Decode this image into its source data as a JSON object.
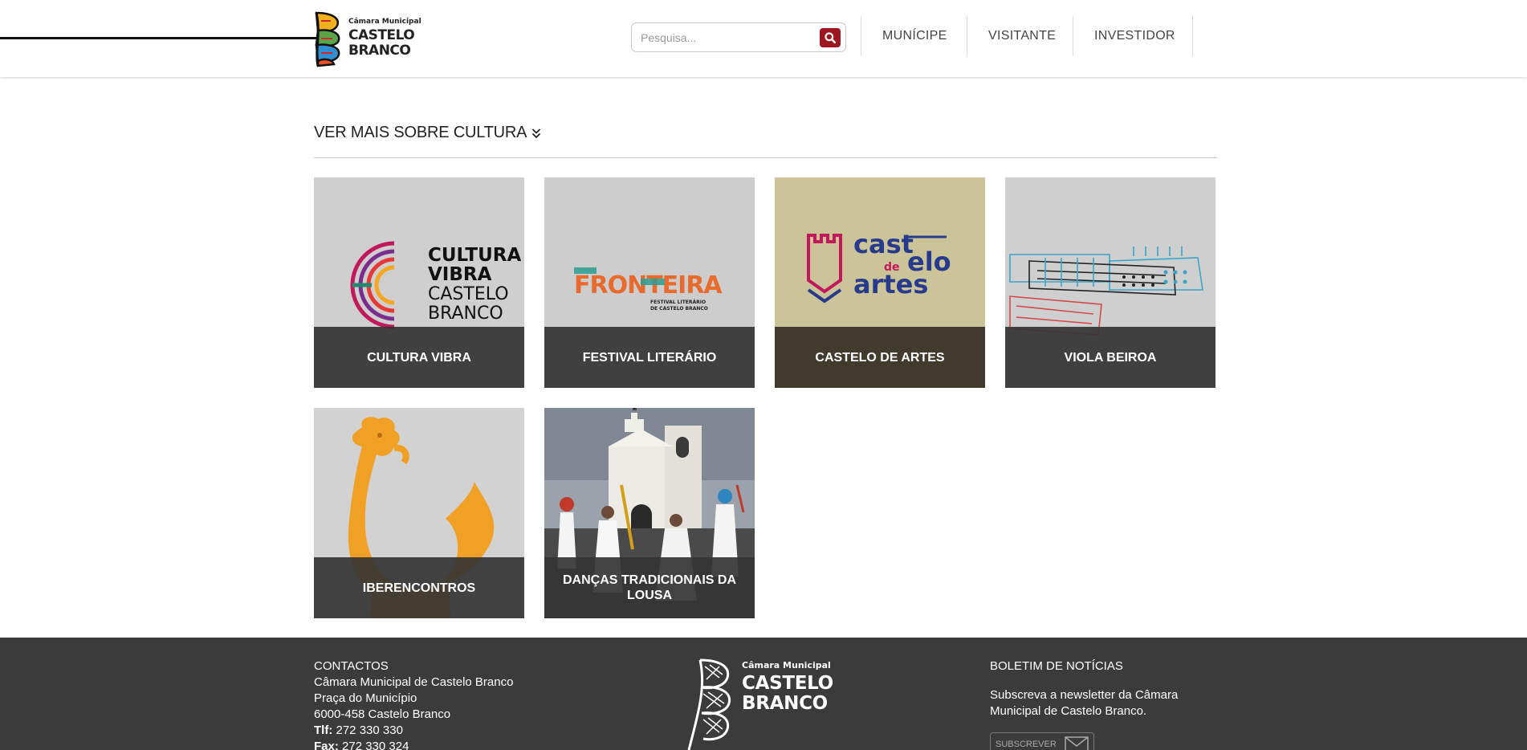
{
  "header": {
    "logo": {
      "small": "Câmara Municipal",
      "line1": "CASTELO",
      "line2": "BRANCO"
    },
    "search": {
      "placeholder": "Pesquisa..."
    },
    "nav": [
      "MUNÍCIPE",
      "VISITANTE",
      "INVESTIDOR"
    ],
    "colors": {
      "search_button": "#9e1620"
    }
  },
  "section": {
    "title": "VER MAIS SOBRE CULTURA",
    "cards": [
      {
        "label": "CULTURA VIBRA",
        "art": {
          "line1": "CULTURA",
          "line2": "VIBRA",
          "line3": "CASTELO",
          "line4": "BRANCO"
        }
      },
      {
        "label": "FESTIVAL LITERÁRIO",
        "art": {
          "word": "FRONTEIRA",
          "sub1": "FESTIVAL LITERÁRIO",
          "sub2": "DE CASTELO BRANCO"
        }
      },
      {
        "label": "CASTELO DE ARTES",
        "art": {
          "w1": "cast",
          "w2": "elo",
          "w3": "de",
          "w4": "artes"
        }
      },
      {
        "label": "VIOLA BEIROA"
      },
      {
        "label": "IBERENCONTROS"
      },
      {
        "label": "DANÇAS TRADICIONAIS DA LOUSA"
      }
    ]
  },
  "footer": {
    "contacts": {
      "title": "CONTACTOS",
      "line1": "Câmara Municipal de Castelo Branco",
      "line2": "Praça do Município",
      "line3": "6000-458 Castelo Branco",
      "phone_label": "Tlf:",
      "phone": "272 330 330",
      "fax_label": "Fax:",
      "fax": "272 330 324"
    },
    "logo": {
      "small": "Câmara Municipal",
      "line1": "CASTELO",
      "line2": "BRANCO"
    },
    "newsletter": {
      "title": "BOLETIM DE NOTÍCIAS",
      "desc": "Subscreva a newsletter da Câmara Municipal de Castelo Branco.",
      "button": "SUBSCREVER"
    }
  }
}
